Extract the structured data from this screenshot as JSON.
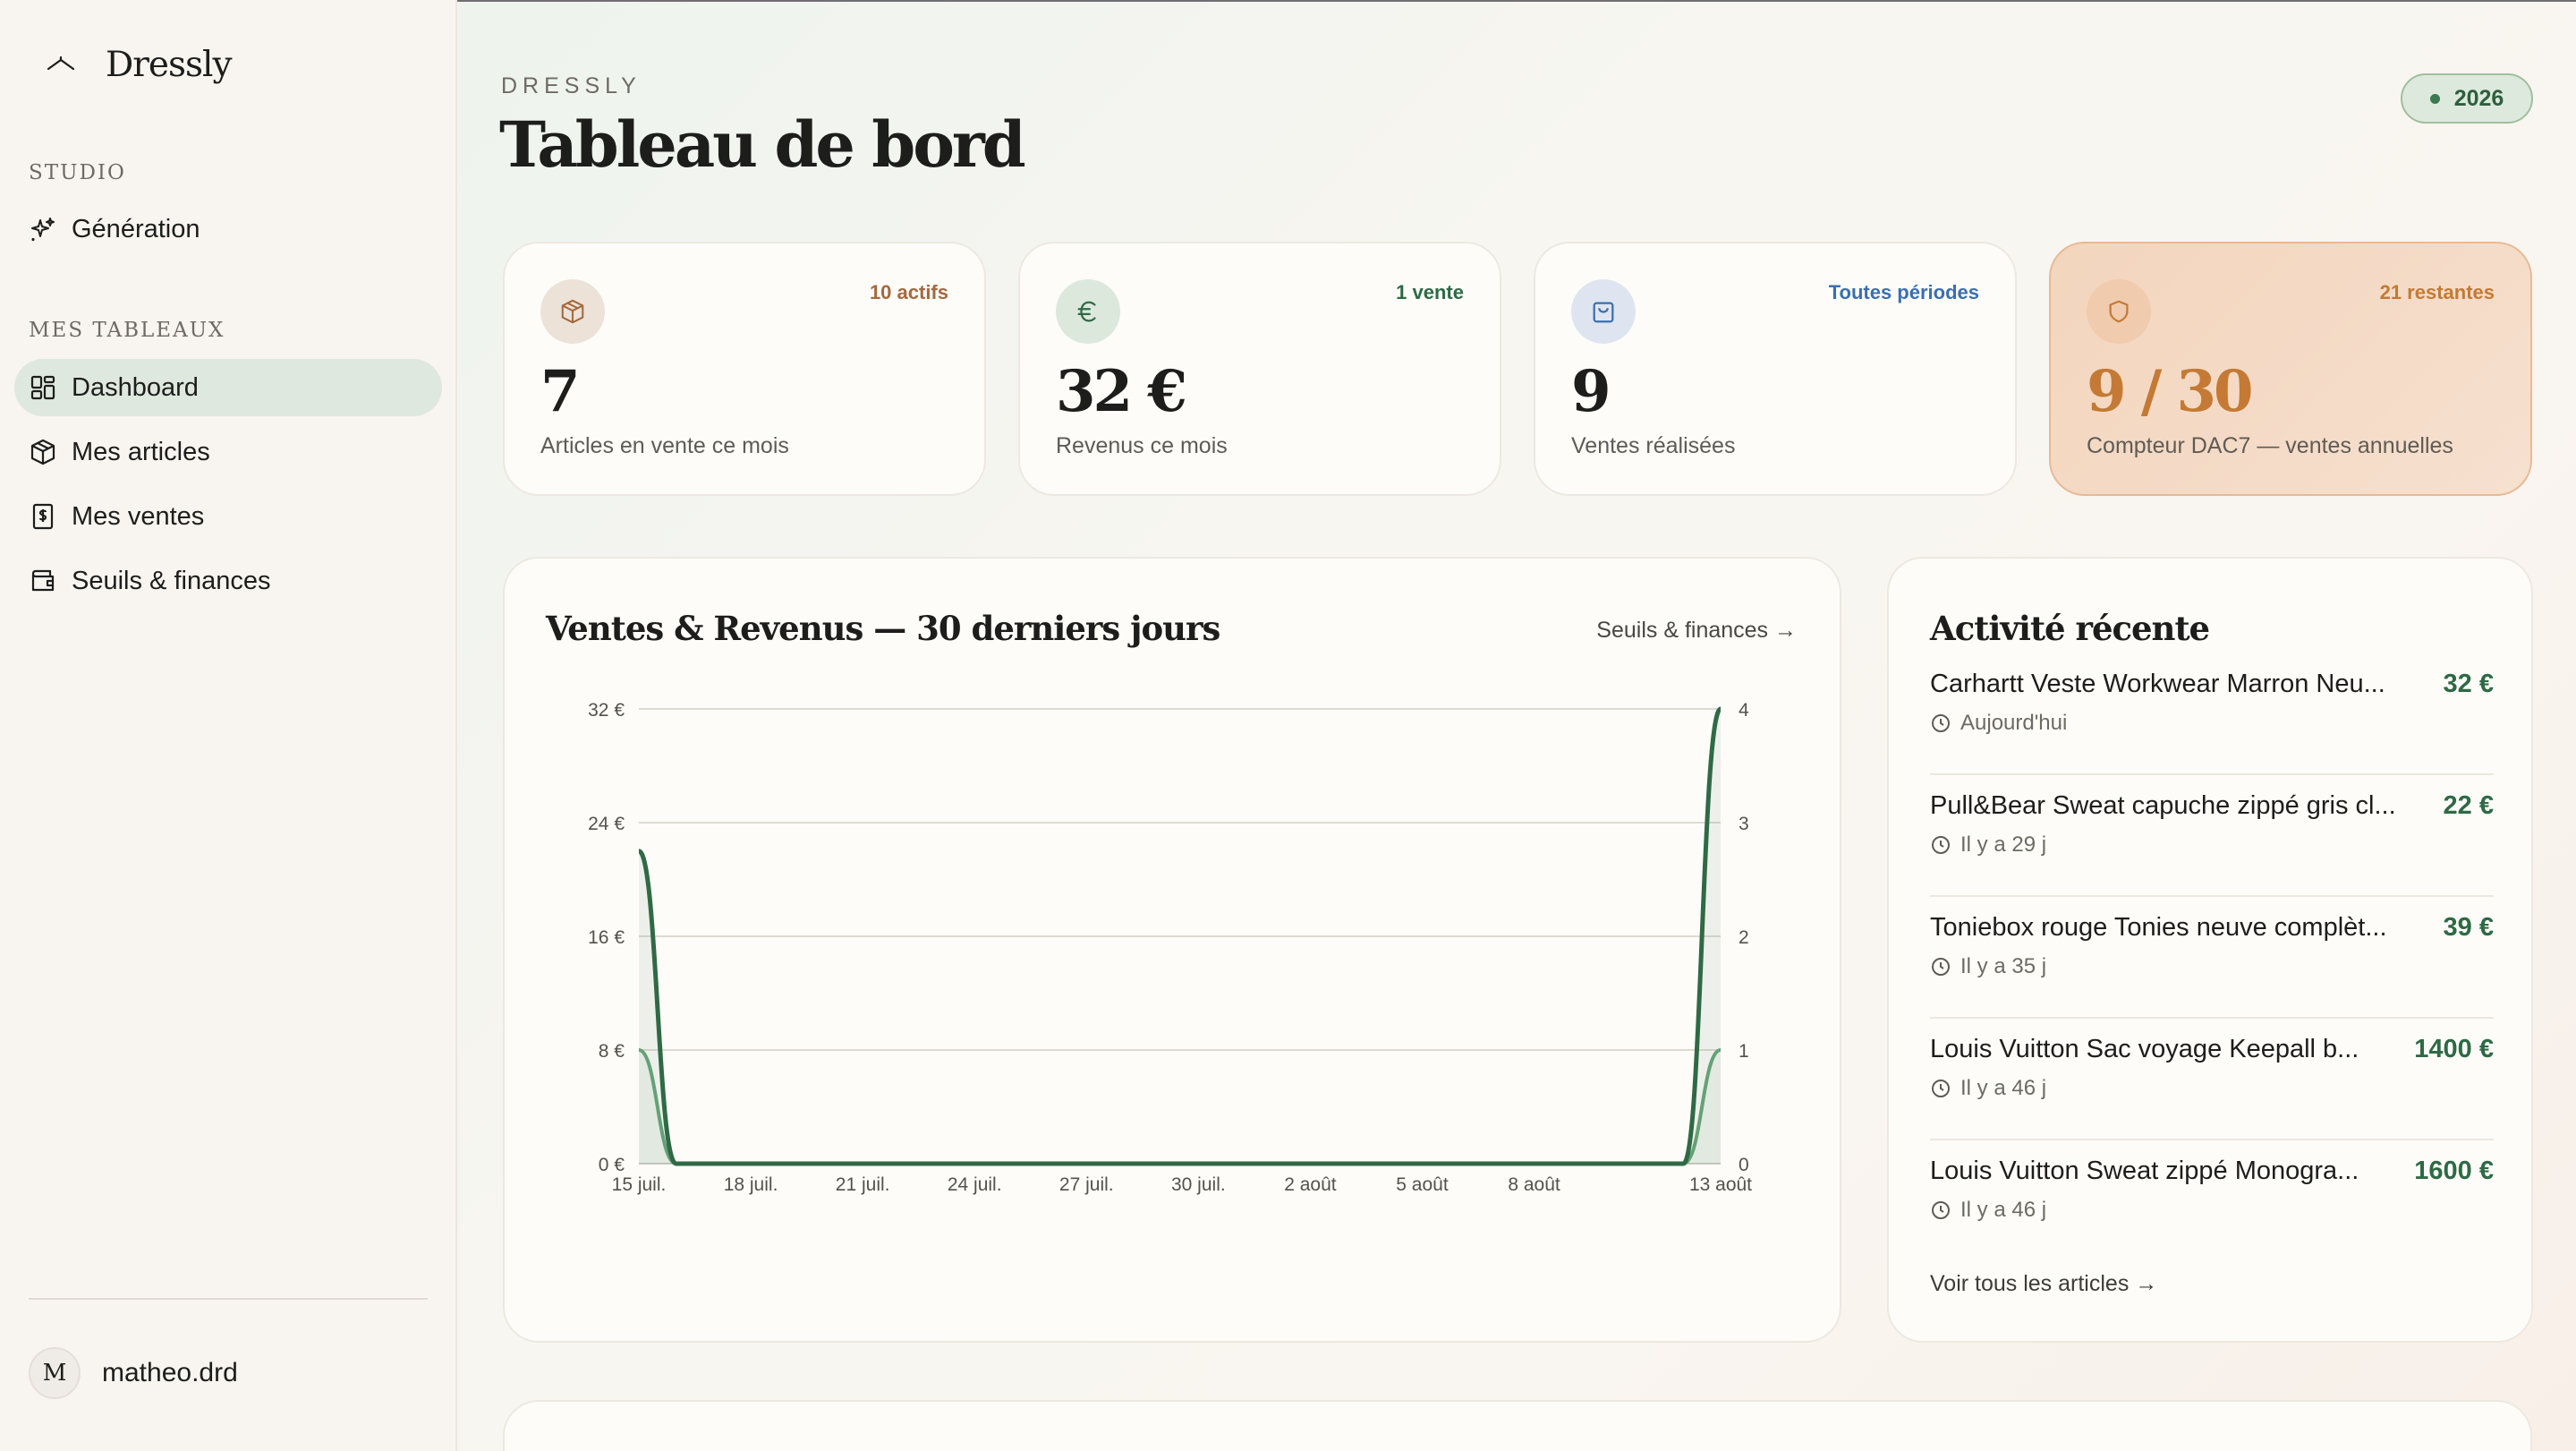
{
  "sidebar": {
    "brand": "Dressly",
    "sections": [
      {
        "label": "STUDIO",
        "items": [
          {
            "label": "Génération",
            "icon": "sparkles-icon"
          }
        ]
      },
      {
        "label": "MES TABLEAUX",
        "items": [
          {
            "label": "Dashboard",
            "icon": "grid-icon",
            "active": true
          },
          {
            "label": "Mes articles",
            "icon": "box-icon"
          },
          {
            "label": "Mes ventes",
            "icon": "receipt-icon"
          },
          {
            "label": "Seuils & finances",
            "icon": "wallet-icon"
          }
        ]
      }
    ],
    "user": {
      "initial": "M",
      "name": "matheo.drd"
    }
  },
  "header": {
    "eyebrow": "DRESSLY",
    "title": "Tableau de bord",
    "year": "2026"
  },
  "stats": [
    {
      "badge": "10 actifs",
      "value": "7",
      "label": "Articles en vente ce mois",
      "icon": "box-icon",
      "accent": "#a5693f"
    },
    {
      "badge": "1 vente",
      "value": "32 €",
      "label": "Revenus ce mois",
      "icon": "euro-icon",
      "accent": "#2e6a45"
    },
    {
      "badge": "Toutes périodes",
      "value": "9",
      "label": "Ventes réalisées",
      "icon": "bag-icon",
      "accent": "#3a6fb0"
    },
    {
      "badge": "21 restantes",
      "value": "9 / 30",
      "label": "Compteur DAC7 — ventes annuelles",
      "icon": "shield-icon",
      "accent": "#c47a34"
    }
  ],
  "chart_card": {
    "title": "Ventes & Revenus — 30 derniers jours",
    "link": "Seuils & finances →"
  },
  "chart_data": {
    "type": "line",
    "x": [
      "15 juil.",
      "16 juil.",
      "17 juil.",
      "18 juil.",
      "19 juil.",
      "20 juil.",
      "21 juil.",
      "22 juil.",
      "23 juil.",
      "24 juil.",
      "25 juil.",
      "26 juil.",
      "27 juil.",
      "28 juil.",
      "29 juil.",
      "30 juil.",
      "31 juil.",
      "1 août",
      "2 août",
      "3 août",
      "4 août",
      "5 août",
      "6 août",
      "7 août",
      "8 août",
      "9 août",
      "10 août",
      "11 août",
      "12 août",
      "13 août"
    ],
    "x_tick_labels": [
      "15 juil.",
      "18 juil.",
      "21 juil.",
      "24 juil.",
      "27 juil.",
      "30 juil.",
      "2 août",
      "5 août",
      "8 août",
      "13 août"
    ],
    "series": [
      {
        "axis": "left",
        "color": "#2f6a45",
        "values": [
          22,
          0,
          0,
          0,
          0,
          0,
          0,
          0,
          0,
          0,
          0,
          0,
          0,
          0,
          0,
          0,
          0,
          0,
          0,
          0,
          0,
          0,
          0,
          0,
          0,
          0,
          0,
          0,
          0,
          32
        ]
      },
      {
        "axis": "right",
        "color": "#6aa77c",
        "values": [
          1,
          0,
          0,
          0,
          0,
          0,
          0,
          0,
          0,
          0,
          0,
          0,
          0,
          0,
          0,
          0,
          0,
          0,
          0,
          0,
          0,
          0,
          0,
          0,
          0,
          0,
          0,
          0,
          0,
          1
        ]
      }
    ],
    "y_left": {
      "ticks": [
        "0 €",
        "8 €",
        "16 €",
        "24 €",
        "32 €"
      ],
      "lim": [
        0,
        32
      ]
    },
    "y_right": {
      "ticks": [
        "0",
        "1",
        "2",
        "3",
        "4"
      ],
      "lim": [
        0,
        4
      ]
    },
    "grid": true
  },
  "activity": {
    "title": "Activité récente",
    "items": [
      {
        "title": "Carhartt Veste Workwear Marron Neu...",
        "price": "32 €",
        "time": "Aujourd'hui"
      },
      {
        "title": "Pull&Bear Sweat capuche zippé gris cl...",
        "price": "22 €",
        "time": "Il y a 29 j"
      },
      {
        "title": "Toniebox rouge Tonies neuve complèt...",
        "price": "39 €",
        "time": "Il y a 35 j"
      },
      {
        "title": "Louis Vuitton Sac voyage Keepall b...",
        "price": "1400 €",
        "time": "Il y a 46 j"
      },
      {
        "title": "Louis Vuitton Sweat zippé Monogra...",
        "price": "1600 €",
        "time": "Il y a 46 j"
      }
    ],
    "link": "Voir tous les articles →"
  }
}
